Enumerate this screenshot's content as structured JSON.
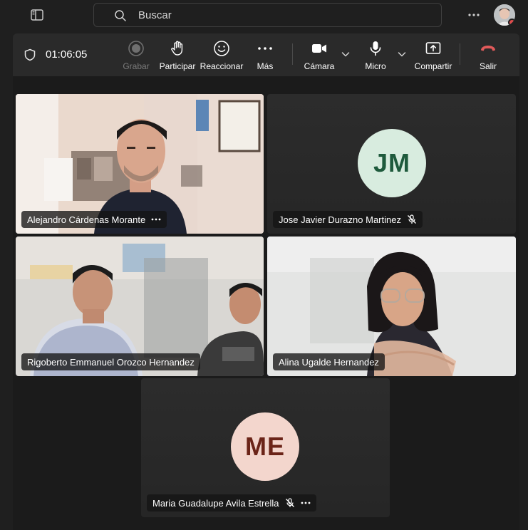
{
  "topbar": {
    "search_placeholder": "Buscar"
  },
  "meeting": {
    "elapsed": "01:06:05"
  },
  "toolbar": {
    "record_label": "Grabar",
    "raise_hand_label": "Participar",
    "react_label": "Reaccionar",
    "more_label": "Más",
    "camera_label": "Cámara",
    "mic_label": "Micro",
    "share_label": "Compartir",
    "leave_label": "Salir"
  },
  "participants": [
    {
      "name": "Alejandro Cárdenas Morante",
      "video": true,
      "muted": false,
      "speaking": false
    },
    {
      "name": "Jose Javier Durazno Martinez",
      "initials": "JM",
      "video": false,
      "muted": true,
      "speaking": false
    },
    {
      "name": "Rigoberto Emmanuel Orozco Hernandez",
      "video": true,
      "muted": false,
      "speaking": false
    },
    {
      "name": "Alina Ugalde Hernandez",
      "video": true,
      "muted": false,
      "speaking": true
    },
    {
      "name": "Maria Guadalupe Avila Estrella",
      "initials": "ME",
      "video": false,
      "muted": true,
      "speaking": false
    }
  ],
  "colors": {
    "accent": "#7f85f5",
    "leave": "#e15a5a",
    "jm_avatar_bg": "#d8ecdf",
    "jm_avatar_fg": "#1e5a3c",
    "me_avatar_bg": "#f3d6cd",
    "me_avatar_fg": "#6b2418"
  }
}
